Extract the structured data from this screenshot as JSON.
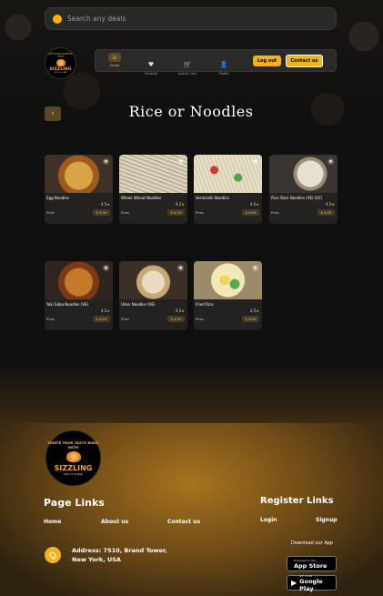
{
  "search": {
    "placeholder": "Search any deals"
  },
  "logo": {
    "tagline": "IGNITE YOUR TASTE BUDS WITH",
    "name": "SIZZLING",
    "sub": "GRILLS & BAR"
  },
  "nav": {
    "items": [
      {
        "label": "Home",
        "icon": "home-icon",
        "glyph": "⌂"
      },
      {
        "label": "Favorite",
        "icon": "heart-icon",
        "glyph": "♥"
      },
      {
        "label": "Add to Cart",
        "icon": "cart-icon",
        "glyph": "🛒"
      },
      {
        "label": "Profile",
        "icon": "user-icon",
        "glyph": "👤"
      }
    ],
    "logout": "Log out",
    "contact": "Contact us"
  },
  "page": {
    "title": "Rice or Noodles",
    "back_glyph": "‹"
  },
  "cards": [
    {
      "name": "Egg Noodles",
      "rating": "4.5",
      "price_label": "Price",
      "price": "$ 4.99"
    },
    {
      "name": "Whole Wheat Noodles",
      "rating": "4.2",
      "price_label": "Price",
      "price": "$ 4.79"
    },
    {
      "name": "Vermicelli Noodles",
      "rating": "4.5",
      "price_label": "Price",
      "price": "$ 4.99"
    },
    {
      "name": "Rice Stick Noodles (VE) (GF)",
      "rating": "4.5",
      "price_label": "Price",
      "price": "$ 4.99"
    },
    {
      "name": "Yaki Soba Noodles (VE)",
      "rating": "4.5",
      "price_label": "Price",
      "price": "$ 4.99"
    },
    {
      "name": "Udon Noodles (VE)",
      "rating": "4.5",
      "price_label": "Price",
      "price": "$ 4.99"
    },
    {
      "name": "Fried Rice",
      "rating": "4.5",
      "price_label": "Price",
      "price": "$ 4.99"
    }
  ],
  "footer": {
    "page_links_title": "Page Links",
    "page_links": [
      "Home",
      "About us",
      "Contact us"
    ],
    "register_title": "Register Links",
    "register_links": [
      "Login",
      "Signup"
    ],
    "address": "Address: 7510, Brand Tower, New York, USA",
    "download_label": "Download our App",
    "app_store": {
      "small": "Download on the",
      "big": "App Store"
    },
    "google_play": {
      "small": "GET IT ON",
      "big": "Google Play"
    }
  },
  "colors": {
    "accent": "#f5b21f",
    "background": "#0f0f0f",
    "card": "#232220"
  }
}
